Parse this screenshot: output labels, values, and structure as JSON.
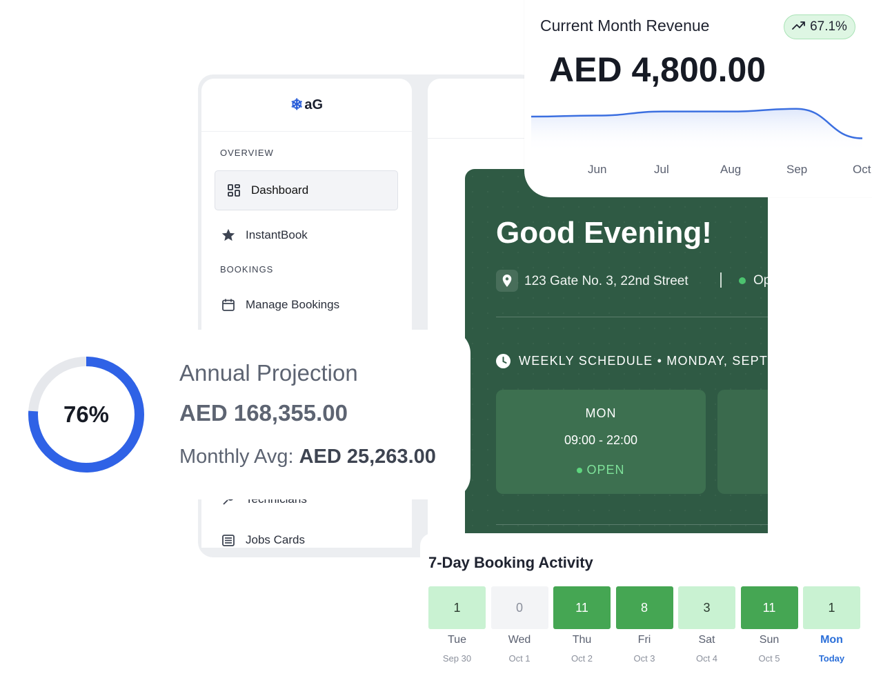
{
  "sidebar": {
    "logo": "aG",
    "sections": {
      "overview": "OVERVIEW",
      "bookings": "BOOKINGS"
    },
    "items": {
      "dashboard": "Dashboard",
      "instantbook": "InstantBook",
      "manage_bookings": "Manage Bookings",
      "technicians": "Technicians",
      "jobs_cards": "Jobs Cards"
    }
  },
  "welcome": {
    "greeting": "Good Evening!",
    "address": "123 Gate No. 3, 22nd Street",
    "status": "Op",
    "schedule_heading": "WEEKLY SCHEDULE • MONDAY, SEPTE",
    "day": {
      "name": "MON",
      "hours": "09:00 - 22:00",
      "status": "OPEN"
    }
  },
  "revenue": {
    "title": "Current Month Revenue",
    "change": "67.1%",
    "amount": "AED 4,800.00",
    "months": [
      "Jun",
      "Jul",
      "Aug",
      "Sep",
      "Oct"
    ],
    "accent": "#3b6fe0"
  },
  "chart_data": {
    "type": "area",
    "x": [
      "Jun",
      "Jul",
      "Aug",
      "Sep",
      "Oct"
    ],
    "values": [
      2600,
      2900,
      2900,
      3100,
      900
    ],
    "ylim": [
      0,
      3500
    ],
    "grid": false
  },
  "annual": {
    "title": "Annual Projection",
    "amount": "AED 168,355.00",
    "monthly_label": "Monthly Avg:",
    "monthly_value": "AED 25,263.00",
    "progress_pct": 76,
    "progress_label": "76%",
    "ring_color": "#2f62e6",
    "track_color": "#e6e8ec"
  },
  "activity": {
    "title": "7-Day Booking Activity",
    "days": [
      {
        "count": "1",
        "day": "Tue",
        "date": "Sep 30",
        "level": "low"
      },
      {
        "count": "0",
        "day": "Wed",
        "date": "Oct 1",
        "level": "none"
      },
      {
        "count": "11",
        "day": "Thu",
        "date": "Oct 2",
        "level": "high"
      },
      {
        "count": "8",
        "day": "Fri",
        "date": "Oct 3",
        "level": "high"
      },
      {
        "count": "3",
        "day": "Sat",
        "date": "Oct 4",
        "level": "low"
      },
      {
        "count": "11",
        "day": "Sun",
        "date": "Oct 5",
        "level": "high"
      },
      {
        "count": "1",
        "day": "Mon",
        "date": "Today",
        "level": "low",
        "today": true
      }
    ],
    "colors": {
      "none": "#f3f4f6",
      "low": "#c9f2d2",
      "high": "#45a653"
    }
  }
}
